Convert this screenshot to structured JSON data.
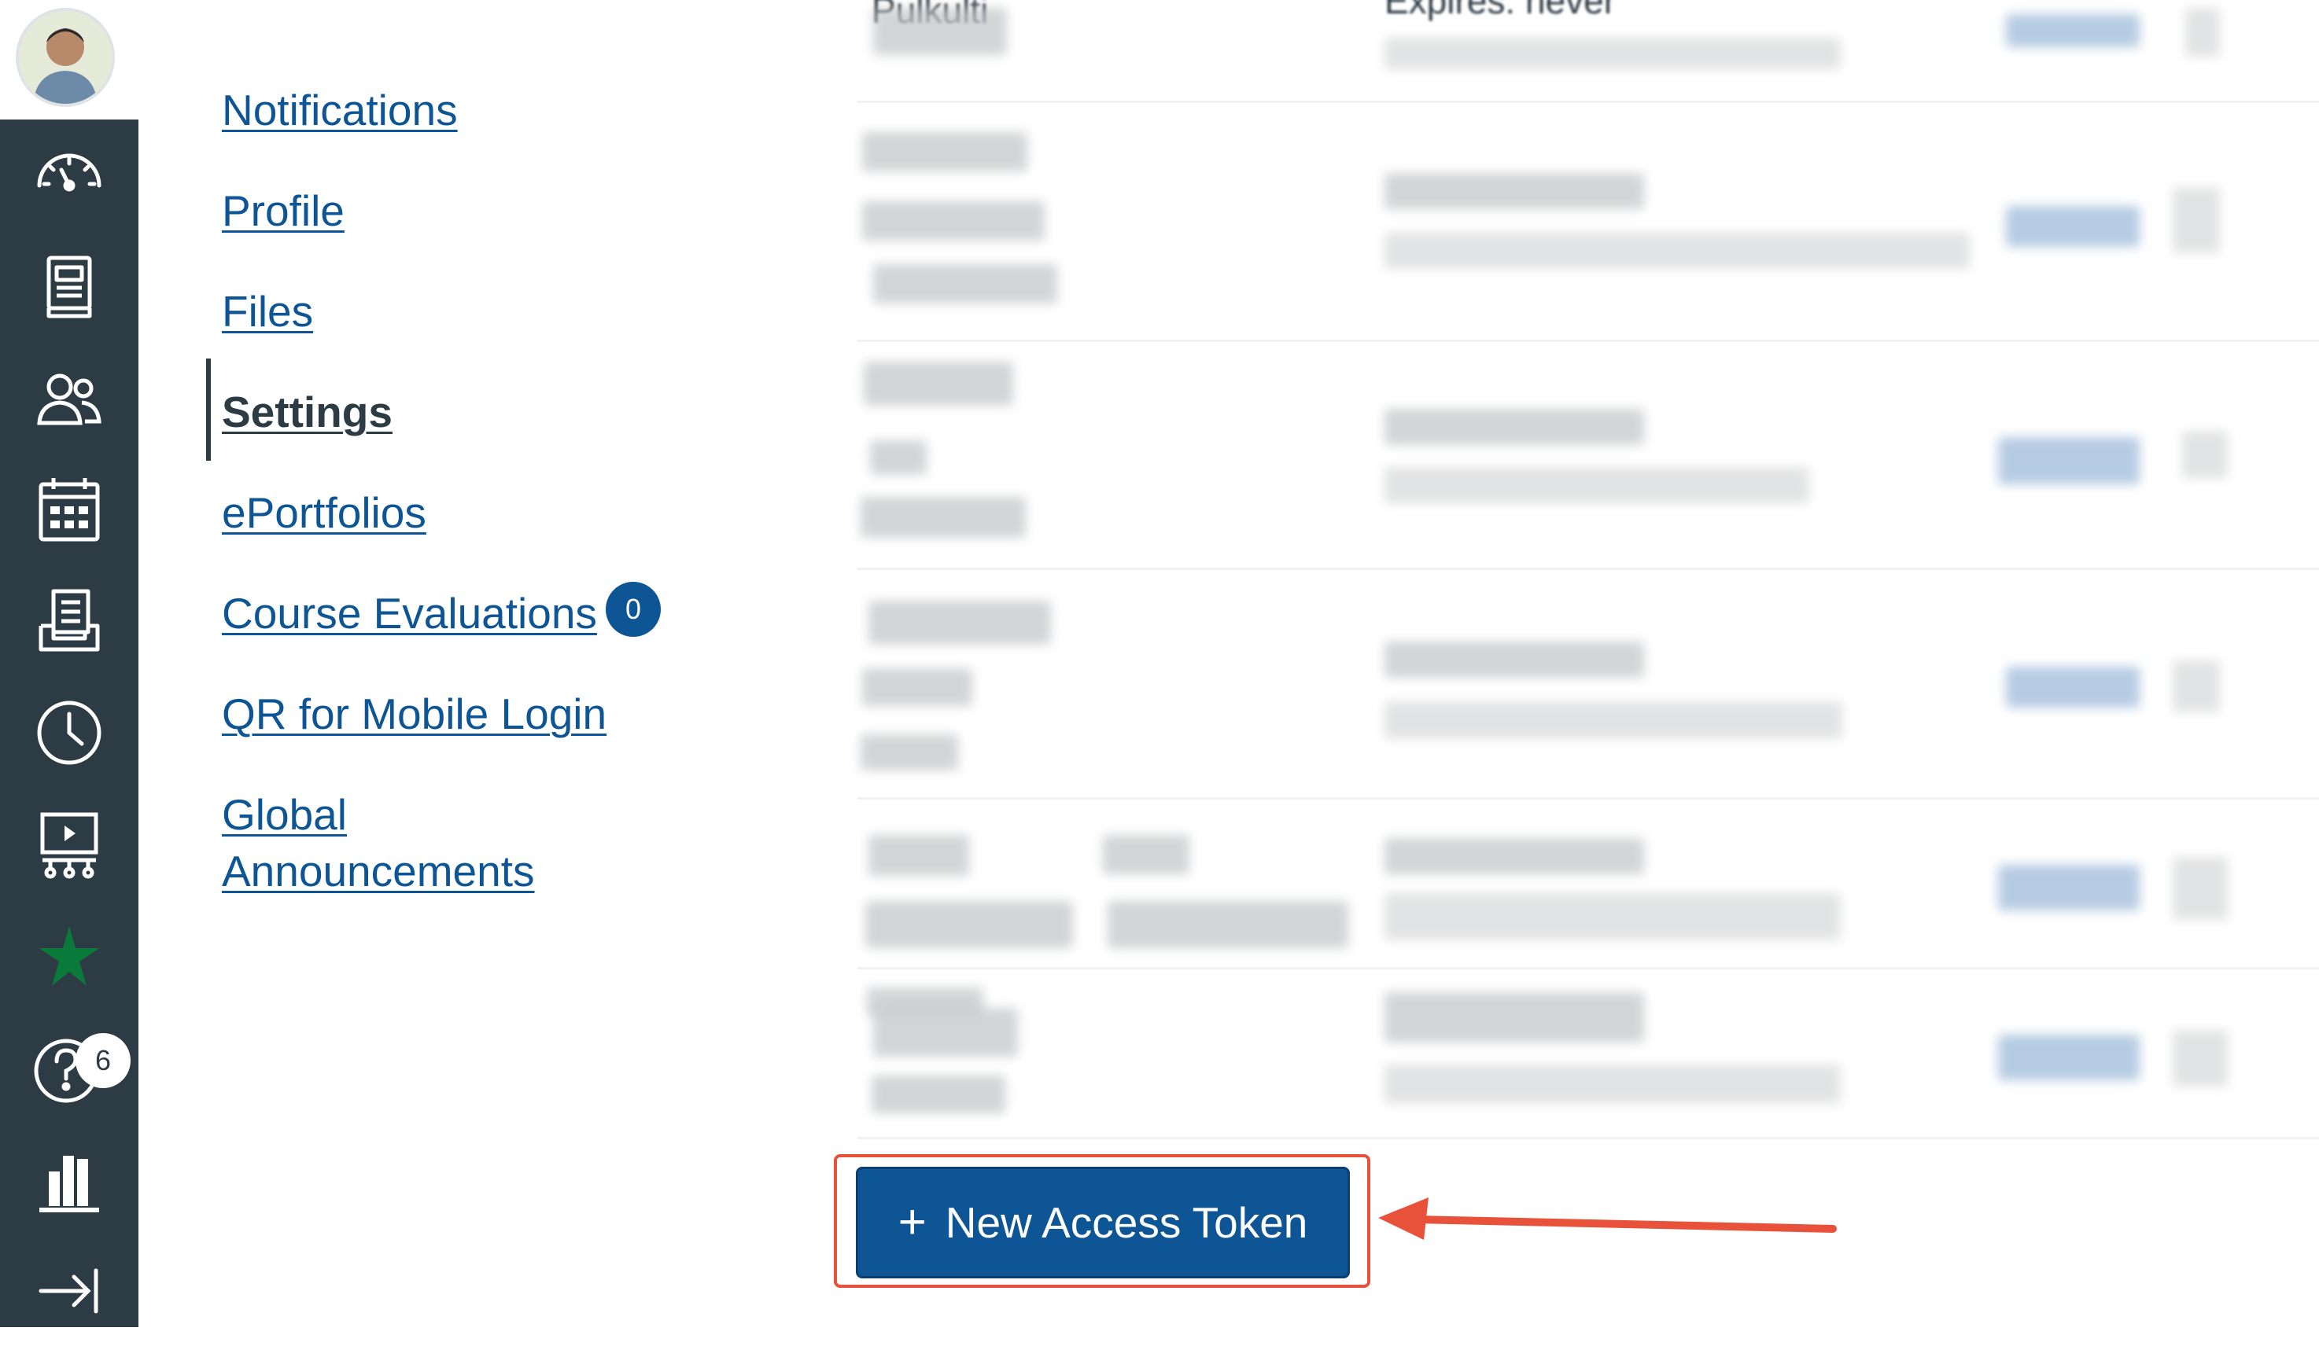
{
  "subnav": {
    "items": [
      {
        "label": "Notifications"
      },
      {
        "label": "Profile"
      },
      {
        "label": "Files"
      },
      {
        "label": "Settings",
        "active": true
      },
      {
        "label": "ePortfolios"
      },
      {
        "label": "Course Evaluations",
        "badge": "0"
      },
      {
        "label": "QR for Mobile Login"
      },
      {
        "label": "Global"
      },
      {
        "label": "Announcements"
      }
    ]
  },
  "global_nav": {
    "help_badge": "6",
    "items": [
      "dashboard-icon",
      "courses-icon",
      "groups-icon",
      "calendar-icon",
      "inbox-icon",
      "history-icon",
      "studio-icon",
      "custom-star-icon",
      "help-icon",
      "library-icon",
      "collapse-icon"
    ]
  },
  "tokens_table": {
    "partial_header_left": "Pulkulti",
    "partial_header_mid": "Expires:     never"
  },
  "new_token_button": {
    "plus": "+",
    "label": "New Access Token"
  },
  "colors": {
    "nav_bg": "#2d3b45",
    "link": "#0e5595",
    "button_bg": "#0e5595",
    "highlight": "#e8513a"
  }
}
